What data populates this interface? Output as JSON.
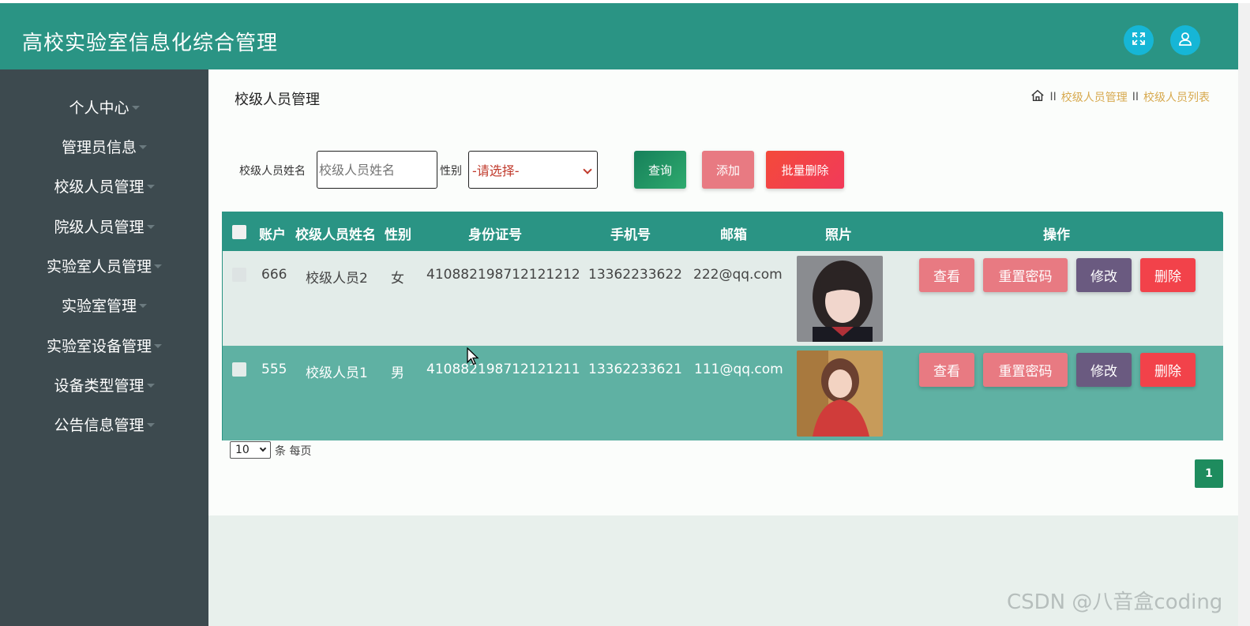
{
  "header": {
    "title": "高校实验室信息化综合管理",
    "fullscreen_icon": "expand-icon",
    "user_icon": "user-icon"
  },
  "sidebar": {
    "items": [
      {
        "label": "个人中心"
      },
      {
        "label": "管理员信息"
      },
      {
        "label": "校级人员管理"
      },
      {
        "label": "院级人员管理"
      },
      {
        "label": "实验室人员管理"
      },
      {
        "label": "实验室管理"
      },
      {
        "label": "实验室设备管理"
      },
      {
        "label": "设备类型管理"
      },
      {
        "label": "公告信息管理"
      }
    ]
  },
  "main": {
    "title": "校级人员管理",
    "breadcrumb": {
      "sep": "II",
      "level1": "校级人员管理",
      "level2": "校级人员列表"
    }
  },
  "search": {
    "name_label": "校级人员姓名",
    "name_placeholder": "校级人员姓名",
    "gender_label": "性别",
    "gender_selected": "-请选择-",
    "query_label": "查询",
    "add_label": "添加",
    "batch_delete_label": "批量删除"
  },
  "table": {
    "headers": [
      "账户",
      "校级人员姓名",
      "性别",
      "身份证号",
      "手机号",
      "邮箱",
      "照片",
      "操作"
    ],
    "rows": [
      {
        "account": "666",
        "name": "校级人员2",
        "gender": "女",
        "id_number": "410882198712121212",
        "phone": "13362233622",
        "email": "222@qq.com"
      },
      {
        "account": "555",
        "name": "校级人员1",
        "gender": "男",
        "id_number": "410882198712121211",
        "phone": "13362233621",
        "email": "111@qq.com"
      }
    ],
    "actions": {
      "view": "查看",
      "reset_password": "重置密码",
      "edit": "修改",
      "delete": "删除"
    }
  },
  "pagination": {
    "page_size": "10",
    "page_size_suffix": "条 每页",
    "current_page": "1"
  },
  "watermark": "CSDN @八音盒coding",
  "colors": {
    "header": "#2a9484",
    "sidebar": "#3d4a4f",
    "query_button": "#1e8c5e",
    "add_button": "#e87a82",
    "delete_button": "#f2424a",
    "edit_button": "#6a5a80"
  }
}
